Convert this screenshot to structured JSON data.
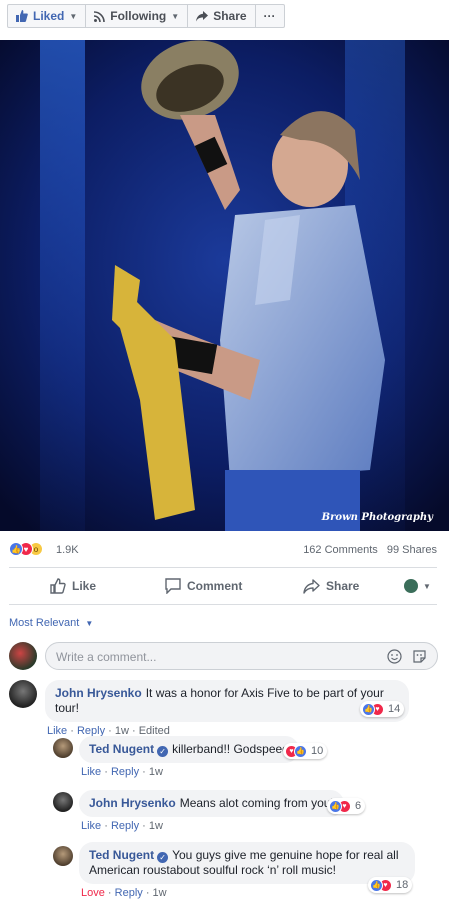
{
  "toolbar": {
    "liked_label": "Liked",
    "following_label": "Following",
    "share_label": "Share",
    "more_label": "···"
  },
  "photo": {
    "credit": "Brown Photography"
  },
  "stats": {
    "reactions_count": "1.9K",
    "comments": "162 Comments",
    "shares": "99 Shares"
  },
  "actions": {
    "like": "Like",
    "comment": "Comment",
    "share": "Share"
  },
  "sort_label": "Most Relevant",
  "write_comment_placeholder": "Write a comment...",
  "comments": [
    {
      "author": "John Hrysenko",
      "text": "It was a honor for Axis Five to be part of your tour!",
      "like": "Like",
      "reply": "Reply",
      "time": "1w",
      "edited": "Edited",
      "reactions": "14"
    },
    {
      "author": "Ted Nugent",
      "text": "killerband!! Godspeed",
      "like": "Like",
      "reply": "Reply",
      "time": "1w",
      "reactions": "10"
    },
    {
      "author": "John Hrysenko",
      "text": "Means alot coming from you!",
      "like": "Like",
      "reply": "Reply",
      "time": "1w",
      "reactions": "6"
    },
    {
      "author": "Ted Nugent",
      "text": "You guys give me genuine hope for real all American roustabout soulful rock ‘n’ roll music!",
      "like": "Love",
      "reply": "Reply",
      "time": "1w",
      "reactions": "18"
    }
  ],
  "colors": {
    "brand_blue": "#4267b2",
    "name_blue": "#385898",
    "love_red": "#f0284a"
  }
}
